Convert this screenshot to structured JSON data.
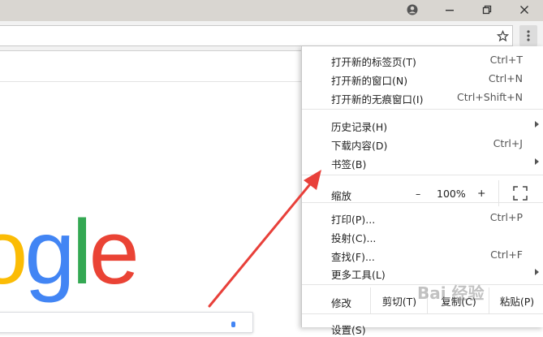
{
  "menu": {
    "items_top": [
      {
        "label": "打开新的标签页(T)",
        "shortcut": "Ctrl+T"
      },
      {
        "label": "打开新的窗口(N)",
        "shortcut": "Ctrl+N"
      },
      {
        "label": "打开新的无痕窗口(I)",
        "shortcut": "Ctrl+Shift+N"
      }
    ],
    "items_history": [
      {
        "label": "历史记录(H)",
        "shortcut": ""
      },
      {
        "label": "下载内容(D)",
        "shortcut": "Ctrl+J"
      },
      {
        "label": "书签(B)",
        "shortcut": ""
      }
    ],
    "zoom": {
      "label": "缩放",
      "minus": "–",
      "value": "100%",
      "plus": "+"
    },
    "items_tools": [
      {
        "label": "打印(P)...",
        "shortcut": "Ctrl+P"
      },
      {
        "label": "投射(C)...",
        "shortcut": ""
      },
      {
        "label": "查找(F)...",
        "shortcut": "Ctrl+F"
      },
      {
        "label": "更多工具(L)",
        "shortcut": ""
      }
    ],
    "edit": {
      "label": "修改",
      "cut": "剪切(T)",
      "copy": "复制(C)",
      "paste": "粘贴(P)"
    },
    "settings": "设置(S)"
  },
  "page": {
    "logo_letters": [
      "o",
      "g",
      "l",
      "e"
    ],
    "logo_colors": [
      "#fbbc05",
      "#4285f4",
      "#34a853",
      "#ea4335"
    ]
  },
  "annotation": {
    "arrow_color": "#e8403a"
  },
  "watermark": "Bai 经验"
}
